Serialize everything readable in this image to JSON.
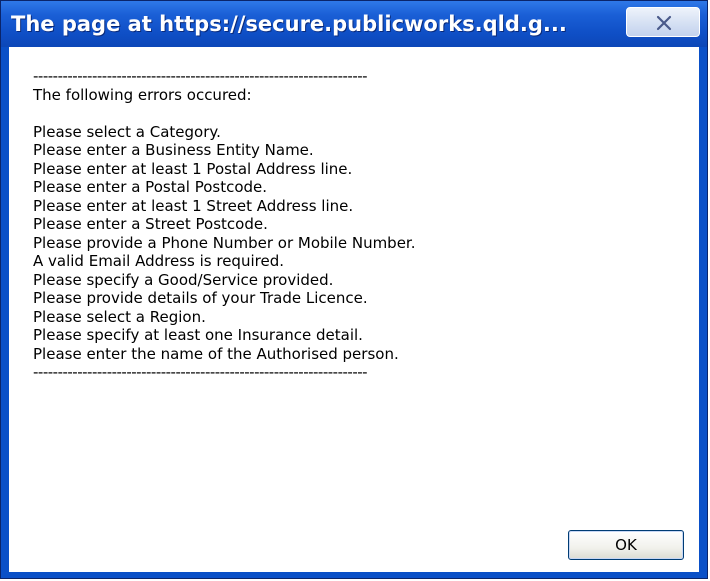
{
  "dialog": {
    "title": "The page at https://secure.publicworks.qld.g...",
    "separator": "--------------------------------------------------------------------",
    "heading": "The following errors occured:",
    "errors": [
      "Please select a Category.",
      "Please enter a Business Entity Name.",
      "Please enter at least 1 Postal Address line.",
      "Please enter a Postal Postcode.",
      "Please enter at least 1 Street Address line.",
      "Please enter a Street Postcode.",
      "Please provide a Phone Number or Mobile Number.",
      "A valid Email Address is required.",
      "Please specify a Good/Service provided.",
      "Please provide details of your Trade Licence.",
      "Please select a Region.",
      "Please specify at least one Insurance detail.",
      "Please enter the name of the Authorised person."
    ],
    "ok_label": "OK",
    "close_icon": "close-x-icon"
  },
  "colors": {
    "titlebar": "#1a5fd6",
    "frame": "#0a50c8",
    "background": "#ffffff"
  }
}
